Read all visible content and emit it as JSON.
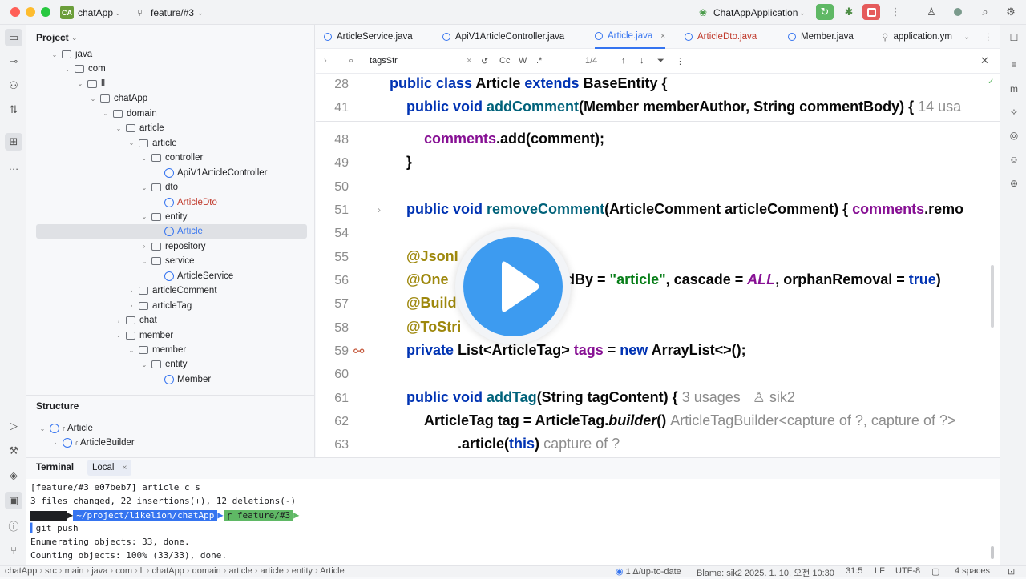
{
  "titlebar": {
    "project_badge": "CA",
    "project_name": "chatApp",
    "branch": "feature/#3",
    "run_config": "ChatAppApplication"
  },
  "project_panel": {
    "title": "Project",
    "tree": [
      {
        "label": "java",
        "kind": "folder",
        "depth": 0,
        "expanded": true
      },
      {
        "label": "com",
        "kind": "folder",
        "depth": 1,
        "expanded": true
      },
      {
        "label": "ll",
        "kind": "folder",
        "depth": 2,
        "expanded": true
      },
      {
        "label": "chatApp",
        "kind": "folder",
        "depth": 3,
        "expanded": true
      },
      {
        "label": "domain",
        "kind": "folder",
        "depth": 4,
        "expanded": true
      },
      {
        "label": "article",
        "kind": "folder",
        "depth": 5,
        "expanded": true
      },
      {
        "label": "article",
        "kind": "folder",
        "depth": 6,
        "expanded": true
      },
      {
        "label": "controller",
        "kind": "folder",
        "depth": 7,
        "expanded": true
      },
      {
        "label": "ApiV1ArticleController",
        "kind": "class",
        "depth": 8
      },
      {
        "label": "dto",
        "kind": "folder",
        "depth": 7,
        "expanded": true
      },
      {
        "label": "ArticleDto",
        "kind": "class-modified",
        "depth": 8
      },
      {
        "label": "entity",
        "kind": "folder",
        "depth": 7,
        "expanded": true
      },
      {
        "label": "Article",
        "kind": "class-selected",
        "depth": 8
      },
      {
        "label": "repository",
        "kind": "folder",
        "depth": 7,
        "expanded": false
      },
      {
        "label": "service",
        "kind": "folder",
        "depth": 7,
        "expanded": true
      },
      {
        "label": "ArticleService",
        "kind": "class",
        "depth": 8
      },
      {
        "label": "articleComment",
        "kind": "folder",
        "depth": 6,
        "expanded": false
      },
      {
        "label": "articleTag",
        "kind": "folder",
        "depth": 6,
        "expanded": false
      },
      {
        "label": "chat",
        "kind": "folder",
        "depth": 5,
        "expanded": false
      },
      {
        "label": "member",
        "kind": "folder",
        "depth": 5,
        "expanded": true
      },
      {
        "label": "member",
        "kind": "folder",
        "depth": 6,
        "expanded": true
      },
      {
        "label": "entity",
        "kind": "folder",
        "depth": 7,
        "expanded": true
      },
      {
        "label": "Member",
        "kind": "class",
        "depth": 8
      }
    ]
  },
  "structure_panel": {
    "title": "Structure",
    "items": [
      {
        "label": "Article"
      },
      {
        "label": "ArticleBuilder"
      }
    ]
  },
  "editor": {
    "tabs": [
      {
        "label": "ArticleService.java",
        "active": false,
        "modified": false
      },
      {
        "label": "ApiV1ArticleController.java",
        "active": false,
        "modified": false
      },
      {
        "label": "Article.java",
        "active": true,
        "modified": false
      },
      {
        "label": "ArticleDto.java",
        "active": false,
        "modified": true
      },
      {
        "label": "Member.java",
        "active": false,
        "modified": false
      },
      {
        "label": "application.ym",
        "active": false,
        "modified": false
      }
    ],
    "find": {
      "query": "tagsStr",
      "case_label": "Cc",
      "word_label": "W",
      "regex_label": ".*",
      "match_count": "1/4"
    },
    "lines": [
      {
        "n": "28",
        "text": ""
      },
      {
        "n": "41",
        "text": ""
      },
      {
        "n": "48",
        "text": ""
      },
      {
        "n": "49",
        "text": "}"
      },
      {
        "n": "50",
        "text": ""
      },
      {
        "n": "51",
        "text": ""
      },
      {
        "n": "54",
        "text": ""
      },
      {
        "n": "55",
        "text": "@JsonI"
      },
      {
        "n": "56",
        "text": ""
      },
      {
        "n": "57",
        "text": "@Build"
      },
      {
        "n": "58",
        "text": "@ToStri"
      },
      {
        "n": "59",
        "text": ""
      },
      {
        "n": "60",
        "text": ""
      },
      {
        "n": "61",
        "text": ""
      },
      {
        "n": "62",
        "text": ""
      },
      {
        "n": "63",
        "text": ""
      }
    ],
    "code_tokens": {
      "l28": [
        "public class ",
        "Article ",
        "extends ",
        "BaseEntity {"
      ],
      "l41": [
        "public void ",
        "addComment",
        "(Member memberAuthor, String commentBody) {",
        "14 usa"
      ],
      "l48": [
        "comments",
        ".add(comment);"
      ],
      "l51": [
        "public void ",
        "removeComment",
        "(ArticleComment articleComment) { ",
        "comments",
        ".remo"
      ],
      "l56": [
        "@One",
        "dBy = ",
        "\"article\"",
        ", cascade = ",
        "ALL",
        ", orphanRemoval = ",
        "true",
        ")"
      ],
      "l59": [
        "private ",
        "List<ArticleTag> ",
        "tags",
        " = ",
        "new ",
        "ArrayList<>();"
      ],
      "l61": [
        "public void ",
        "addTag",
        "(String tagContent) {",
        "3 usages",
        "sik2"
      ],
      "l62": [
        "ArticleTag tag = ArticleTag.",
        "builder",
        "()",
        "ArticleTagBuilder<capture of ?, capture of ?>"
      ],
      "l63": [
        ".article(",
        "this",
        ")",
        "capture of ?"
      ]
    }
  },
  "terminal": {
    "tab_title": "Terminal",
    "tab_local": "Local",
    "lines": [
      "[feature/#3 e07beb7] article c s",
      " 3 files changed, 22 insertions(+), 12 deletions(-)",
      "~/project/likelion/chatApp",
      "feature/#3",
      "git push",
      "Enumerating objects: 33, done.",
      "Counting objects: 100% (33/33), done."
    ]
  },
  "statusbar": {
    "breadcrumb": [
      "chatApp",
      "src",
      "main",
      "java",
      "com",
      "ll",
      "chatApp",
      "domain",
      "article",
      "article",
      "entity",
      "Article"
    ],
    "vcs": "1 Δ/up-to-date",
    "blame": "Blame: sik2 2025. 1. 10. 오전 10:30",
    "position": "31:5",
    "line_ending": "LF",
    "encoding": "UTF-8",
    "indent": "4 spaces"
  },
  "colors": {
    "keyword": "#0033b3",
    "function": "#00627a",
    "field": "#871094",
    "annotation": "#9e880d",
    "string": "#067d17",
    "accent": "#3574f0",
    "play_button": "#3d9bf0",
    "run_green": "#5fb865",
    "stop_red": "#e55b5b"
  }
}
